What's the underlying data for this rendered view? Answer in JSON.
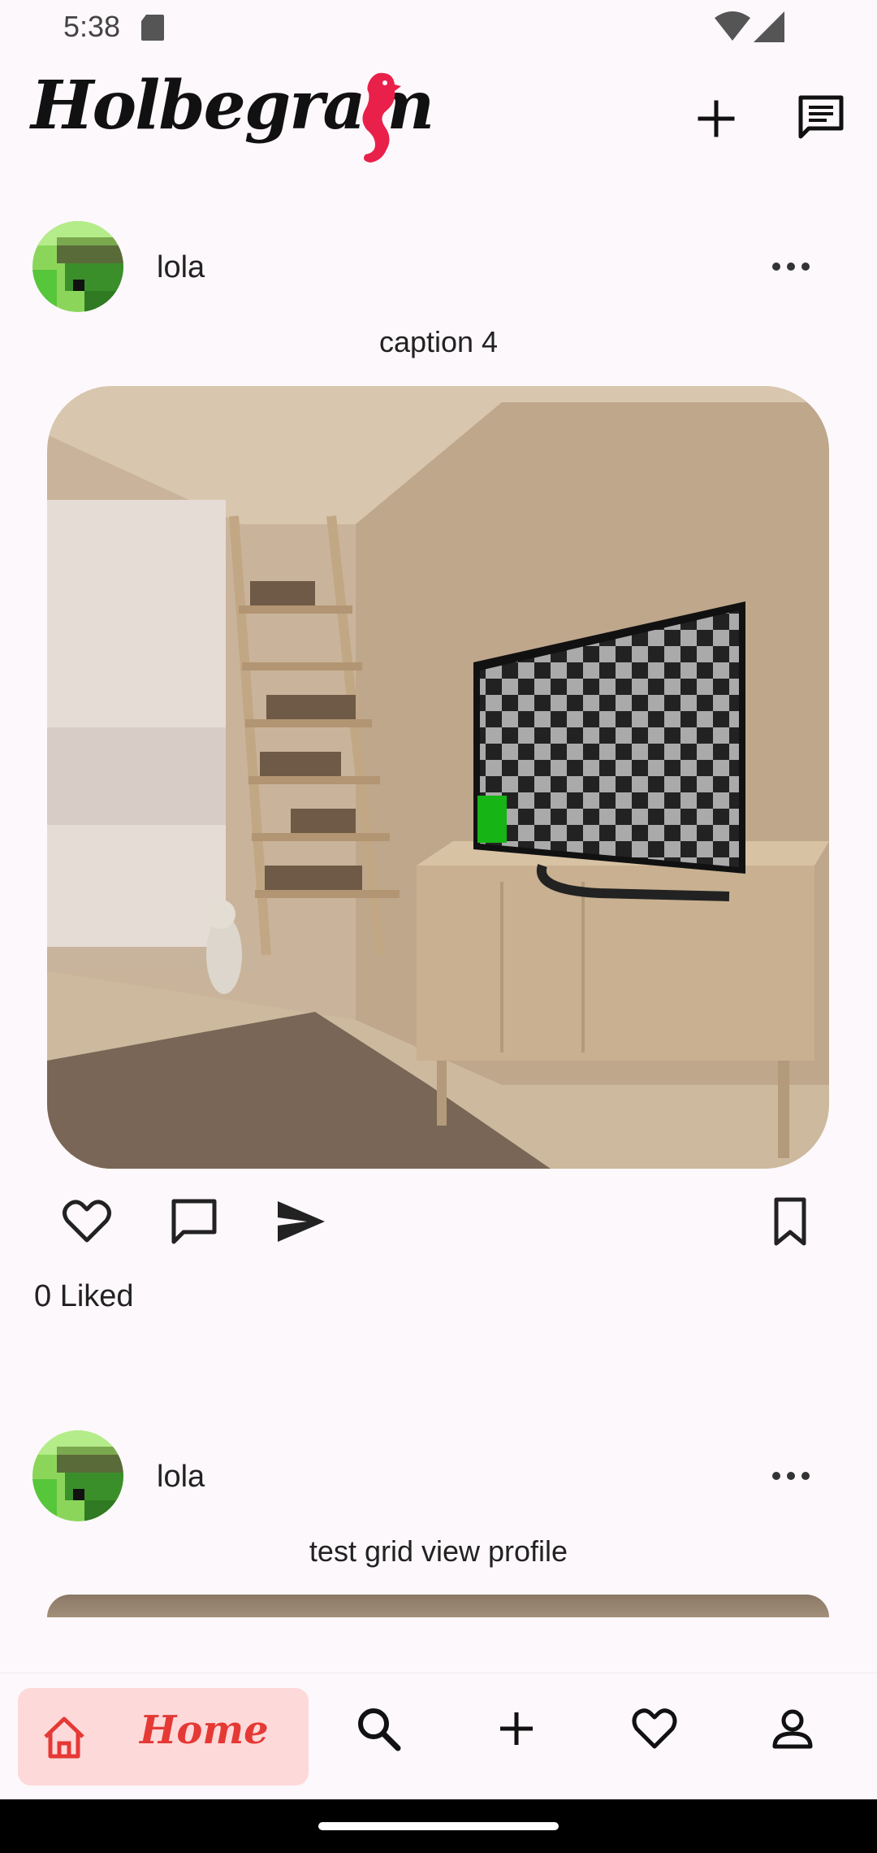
{
  "status_bar": {
    "time": "5:38"
  },
  "app_bar": {
    "title": "Holbegram"
  },
  "posts": [
    {
      "username": "lola",
      "caption": "caption 4",
      "likes_text": "0 Liked"
    },
    {
      "username": "lola",
      "caption": "test grid view profile"
    }
  ],
  "bottom_nav": {
    "items": [
      {
        "label": "Home",
        "icon": "home-icon",
        "selected": true
      },
      {
        "label": "",
        "icon": "search-icon"
      },
      {
        "label": "",
        "icon": "add-icon"
      },
      {
        "label": "",
        "icon": "heart-icon"
      },
      {
        "label": "",
        "icon": "profile-icon"
      }
    ]
  },
  "colors": {
    "accent": "#e53935",
    "nav_selected_bg": "#fdd9d9",
    "background": "#fdf8fb"
  }
}
